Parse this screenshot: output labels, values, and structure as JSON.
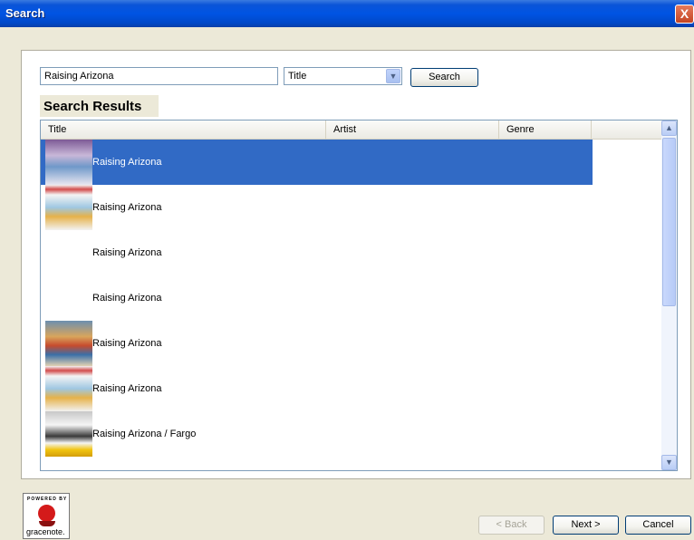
{
  "window": {
    "title": "Search",
    "close_glyph": "X"
  },
  "search": {
    "query": "Raising Arizona",
    "field_selected": "Title",
    "button_label": "Search"
  },
  "results": {
    "heading": "Search Results",
    "columns": [
      "Title",
      "Artist",
      "Genre"
    ],
    "rows": [
      {
        "title": "Raising Arizona",
        "has_thumbnail": true,
        "selected": true
      },
      {
        "title": "Raising Arizona",
        "has_thumbnail": true,
        "selected": false
      },
      {
        "title": "Raising Arizona",
        "has_thumbnail": false,
        "selected": false
      },
      {
        "title": "Raising Arizona",
        "has_thumbnail": false,
        "selected": false
      },
      {
        "title": "Raising Arizona",
        "has_thumbnail": true,
        "selected": false
      },
      {
        "title": "Raising Arizona",
        "has_thumbnail": true,
        "selected": false
      },
      {
        "title": "Raising Arizona / Fargo",
        "has_thumbnail": true,
        "selected": false
      }
    ]
  },
  "footer": {
    "powered_by": "POWERED BY",
    "logo_text": "gracenote.",
    "back_label": "< Back",
    "next_label": "Next >",
    "cancel_label": "Cancel"
  },
  "colors": {
    "titlebar": "#0054e3",
    "selection": "#316ac5",
    "logo_red": "#d41a1a"
  }
}
